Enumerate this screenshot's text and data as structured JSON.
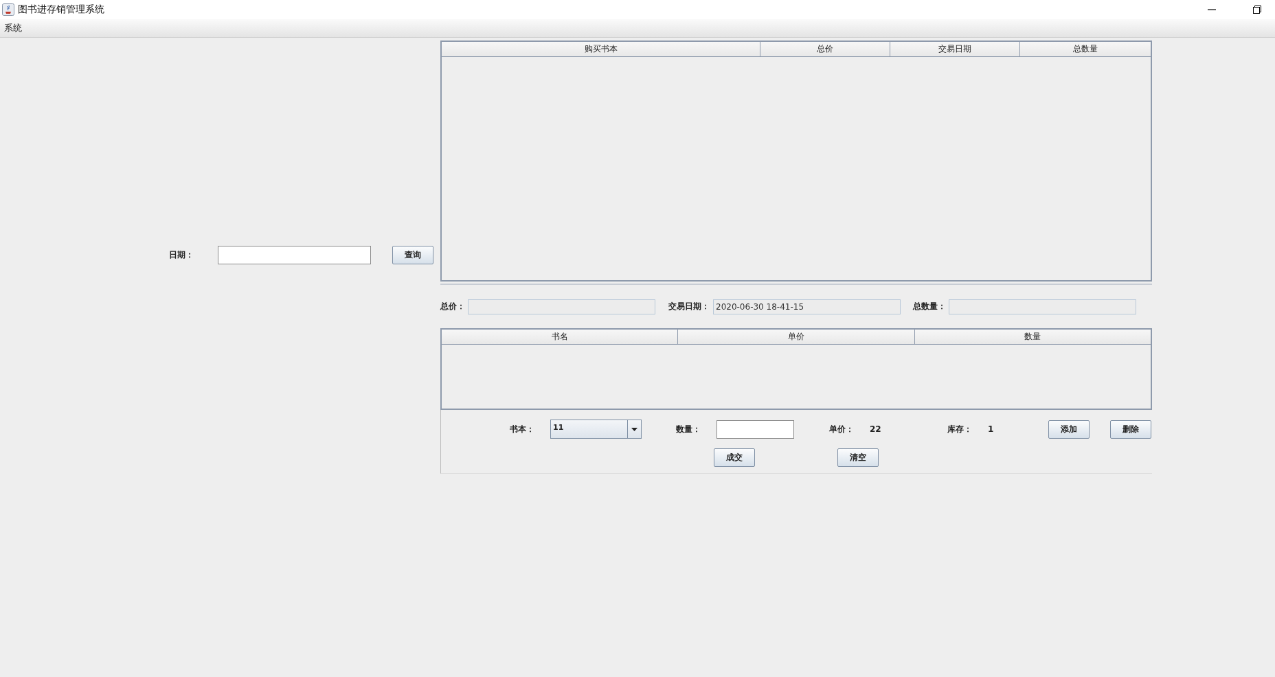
{
  "window": {
    "title": "图书进存销管理系统"
  },
  "menu_bar": {
    "items": [
      "系统"
    ]
  },
  "query": {
    "label": "日期：",
    "button": "查询"
  },
  "orders_table": {
    "columns": [
      "购买书本",
      "总价",
      "交易日期",
      "总数量"
    ]
  },
  "summary": [
    {
      "label": "总价：",
      "disabled": true
    },
    {
      "label": "交易日期：",
      "value": "2020-06-30 18-41-15",
      "disabled": true
    },
    {
      "label": "总数量：",
      "disabled": true
    }
  ],
  "items_table": {
    "columns": [
      "书名",
      "单价",
      "数量"
    ]
  },
  "entry": {
    "book": {
      "label": "书本：",
      "value": "11"
    },
    "quantity": {
      "label": "数量："
    },
    "price": {
      "label": "单价：",
      "value": "22"
    },
    "stock": {
      "label": "库存：",
      "value": "1"
    },
    "buttons": [
      "添加",
      "删除"
    ]
  },
  "actions": [
    "成交",
    "清空"
  ]
}
